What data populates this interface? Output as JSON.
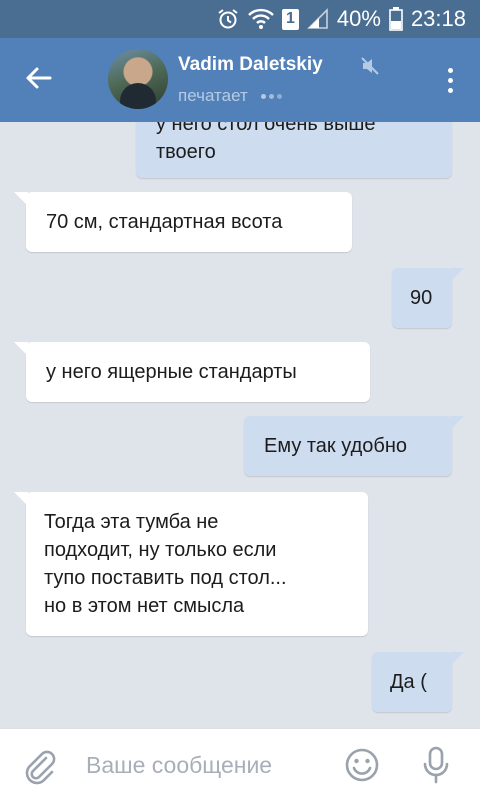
{
  "status_bar": {
    "sim": "1",
    "battery": "40%",
    "time": "23:18"
  },
  "header": {
    "contact_name": "Vadim Daletskiy",
    "status": "печатает"
  },
  "messages": [
    {
      "direction": "out",
      "lines": [
        "у него стол очень выше",
        "твоего"
      ]
    },
    {
      "direction": "in",
      "lines": [
        "70 см, стандартная всота"
      ]
    },
    {
      "direction": "out",
      "lines": [
        "90"
      ]
    },
    {
      "direction": "in",
      "lines": [
        "у него ящерные стандарты"
      ]
    },
    {
      "direction": "out",
      "lines": [
        "Ему так удобно"
      ]
    },
    {
      "direction": "in",
      "lines": [
        "Тогда эта тумба не",
        "подходит, ну только если",
        "тупо поставить под стол...",
        "но в этом нет смысла"
      ]
    },
    {
      "direction": "out",
      "lines": [
        "Да ("
      ]
    }
  ],
  "composer": {
    "placeholder": "Ваше сообщение"
  },
  "colors": {
    "header": "#5181b8",
    "status_bar": "#4a6d92",
    "chat_background": "#dfe3ea",
    "incoming_bubble": "#ffffff",
    "outgoing_bubble": "#cedcf0"
  },
  "icons": [
    "back-arrow-icon",
    "mute-icon",
    "more-vertical-icon",
    "alarm-icon",
    "wifi-icon",
    "signal-icon",
    "battery-icon",
    "attach-icon",
    "emoji-icon",
    "microphone-icon"
  ]
}
